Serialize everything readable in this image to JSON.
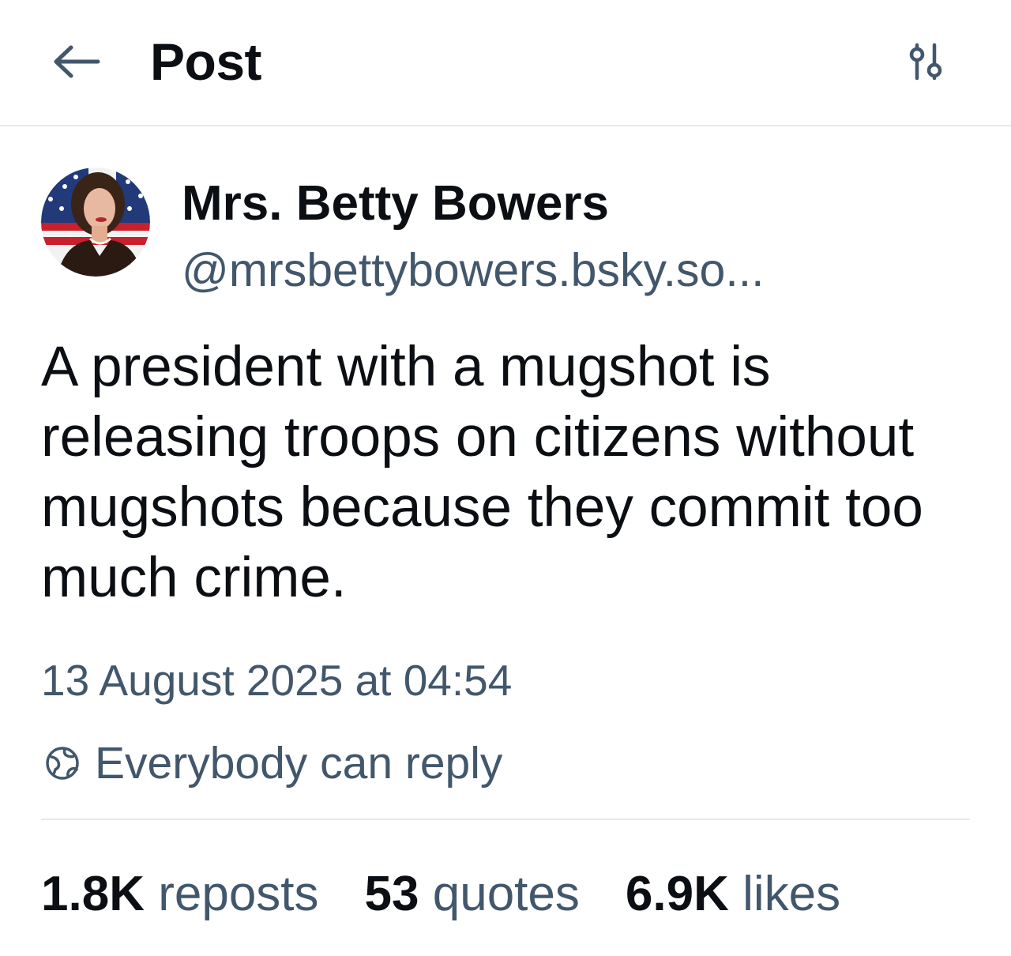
{
  "header": {
    "title": "Post",
    "back_icon": "arrow-left-icon",
    "settings_icon": "sliders-icon"
  },
  "author": {
    "name": "Mrs. Betty Bowers",
    "handle": "@mrsbettybowers.bsky.so..."
  },
  "post": {
    "text": "A president with a mugshot is releasing troops on citizens without mugshots because they commit too much crime.",
    "timestamp": "13 August 2025 at 04:54",
    "reply_setting": "Everybody can reply",
    "reply_icon": "globe-icon"
  },
  "stats": {
    "reposts_count": "1.8K",
    "reposts_label": "reposts",
    "quotes_count": "53",
    "quotes_label": "quotes",
    "likes_count": "6.9K",
    "likes_label": "likes"
  },
  "colors": {
    "text_primary": "#0b0f14",
    "text_secondary": "#42576c",
    "divider": "#e6e9ec",
    "background": "#ffffff"
  }
}
